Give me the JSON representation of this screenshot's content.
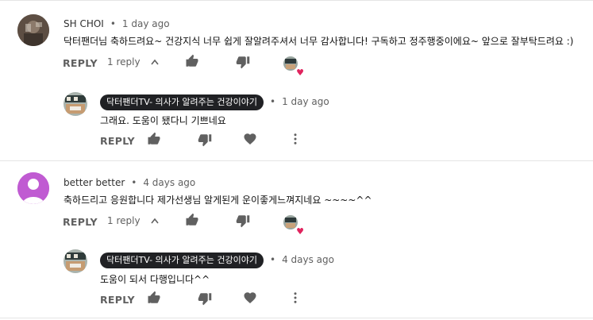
{
  "comments": [
    {
      "author": "SH CHOI",
      "time": "1 day ago",
      "text": "닥터팬더님 축하드려요~ 건강지식 너무 쉽게 잘알려주셔서 너무 감사합니다! 구독하고 정주행중이에요~ 앞으로 잘부탁드려요 :)",
      "reply_label": "REPLY",
      "replies_count": "1 reply",
      "reply": {
        "author": "닥터팬더TV- 의사가 알려주는 건강이야기",
        "time": "1 day ago",
        "text": "그래요. 도움이 됐다니 기쁘네요",
        "reply_label": "REPLY"
      }
    },
    {
      "author": "better better",
      "time": "4 days ago",
      "text": "축하드리고 응원합니다 제가선생님 알게된게 운이좋게느껴지네요 ~~~~^^",
      "reply_label": "REPLY",
      "replies_count": "1 reply",
      "reply": {
        "author": "닥터팬더TV- 의사가 알려주는 건강이야기",
        "time": "4 days ago",
        "text": "도움이 되서 다행입니다^^",
        "reply_label": "REPLY"
      }
    }
  ],
  "colors": {
    "separator": "#e5e5e5",
    "heart": "#e0245e",
    "badge_bg": "#202124",
    "avatar_purple": "#c05bd2"
  },
  "icons": [
    "dot-icon",
    "chevron-up-icon",
    "thumb-up-icon",
    "thumb-down-icon",
    "heart-icon",
    "more-vert-icon",
    "creator-heart-icon",
    "default-avatar-icon"
  ]
}
